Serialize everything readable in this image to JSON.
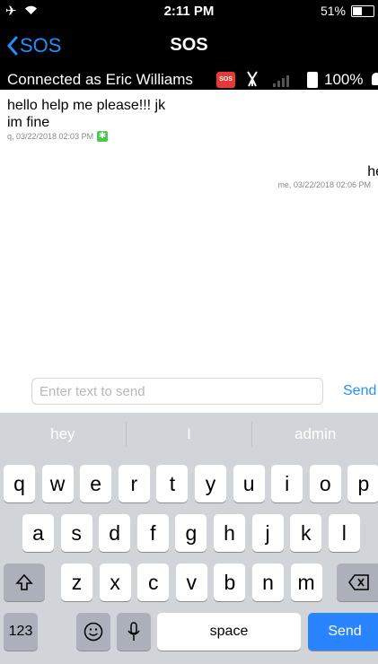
{
  "status_bar": {
    "time": "2:11 PM",
    "battery": "51%",
    "battery_level": 0.51
  },
  "nav": {
    "back_label": "SOS",
    "title": "SOS"
  },
  "connection": {
    "text": "Connected as Eric Williams",
    "sos_badge": "SOS",
    "battery_pct": "100%"
  },
  "messages": [
    {
      "text": "hello help me please!!! jk\nim fine",
      "meta": "q, 03/22/2018 02:03 PM",
      "status_icon": "delivered-check-icon"
    },
    {
      "text": "he",
      "meta": "me, 03/22/2018 02:06 PM"
    }
  ],
  "compose": {
    "placeholder": "Enter text to send",
    "value": "",
    "send_label": "Send"
  },
  "keyboard": {
    "suggestions": [
      "hey",
      "I",
      "admin"
    ],
    "row1": [
      "q",
      "w",
      "e",
      "r",
      "t",
      "y",
      "u",
      "i",
      "o",
      "p"
    ],
    "row2": [
      "a",
      "s",
      "d",
      "f",
      "g",
      "h",
      "j",
      "k",
      "l"
    ],
    "row3": [
      "z",
      "x",
      "c",
      "v",
      "b",
      "n",
      "m"
    ],
    "numbers_label": "123",
    "space_label": "space",
    "send_label": "Send"
  }
}
